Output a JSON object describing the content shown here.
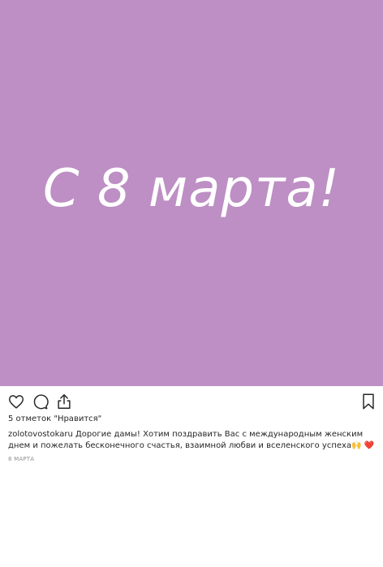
{
  "post": {
    "image_text": "С 8 марта!",
    "image_bg": "#bd8fc4"
  },
  "actions": {
    "like_icon": "heart-icon",
    "comment_icon": "comment-icon",
    "share_icon": "share-icon",
    "save_icon": "bookmark-icon"
  },
  "likes_text": "5 отметок \"Нравится\"",
  "caption": {
    "username": "zolotovostokaru",
    "text": " Дорогие дамы! Хотим поздравить Вас с международным женским днем и пожелать бесконечного счастья, взаимной любви и вселенского успеха",
    "emoji1": "🙌",
    "emoji2": "❤️"
  },
  "date": "8 МАРТА"
}
